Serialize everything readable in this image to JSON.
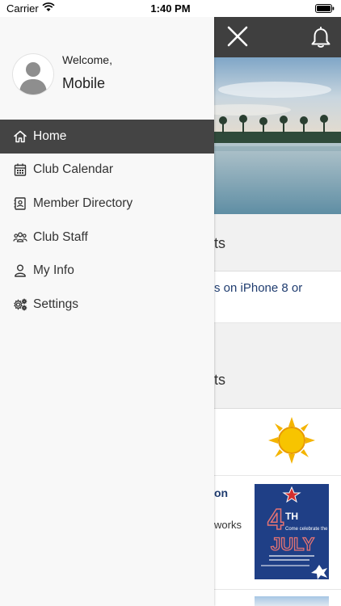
{
  "status_bar": {
    "carrier": "Carrier",
    "time": "1:40 PM"
  },
  "drawer": {
    "welcome": "Welcome,",
    "user_name": "Mobile",
    "menu": [
      {
        "label": "Home",
        "icon": "home-icon",
        "active": true
      },
      {
        "label": "Club Calendar",
        "icon": "calendar-icon",
        "active": false
      },
      {
        "label": "Member Directory",
        "icon": "directory-icon",
        "active": false
      },
      {
        "label": "Club Staff",
        "icon": "staff-icon",
        "active": false
      },
      {
        "label": "My Info",
        "icon": "person-icon",
        "active": false
      },
      {
        "label": "Settings",
        "icon": "gear-icon",
        "active": false
      }
    ]
  },
  "background": {
    "section1_title": "ts",
    "news_link": "s on iPhone 8 or",
    "section2_title": "ts",
    "event_title": "on",
    "event_text": "works",
    "poster": {
      "line1": "4",
      "line2": "TH",
      "line3": "JULY",
      "tagline": "Come celebrate the"
    }
  },
  "colors": {
    "header": "#3f3f3f",
    "active_item": "#444444",
    "drawer_bg": "#f8f8f8",
    "link": "#1f3c6f"
  }
}
